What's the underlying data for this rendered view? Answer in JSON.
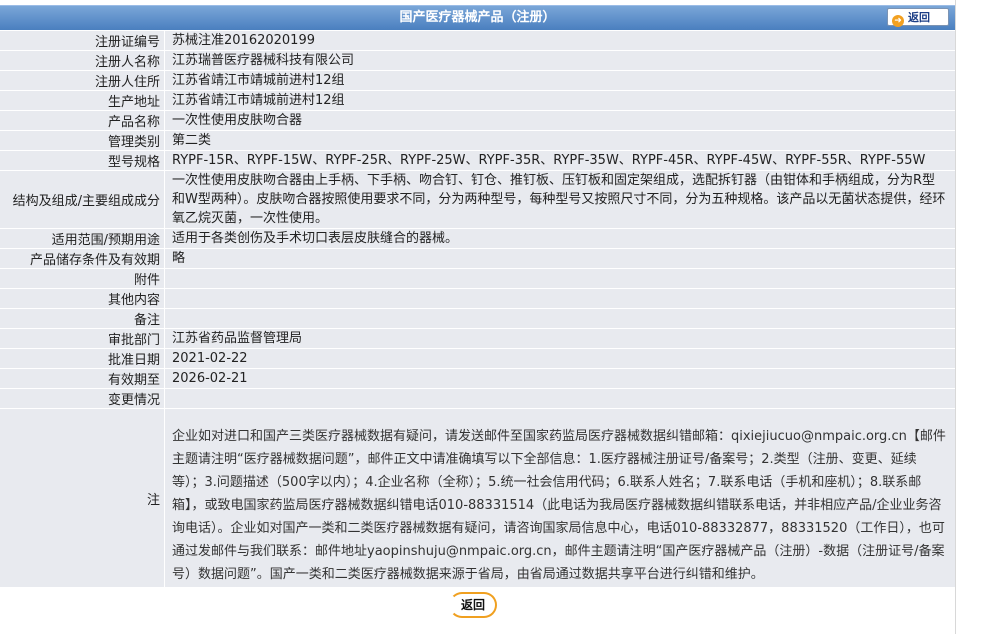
{
  "header": {
    "title": "国产医疗器械产品（注册）",
    "back_label": "返回"
  },
  "rows": [
    {
      "label": "注册证编号",
      "value": "苏械注准20162020199"
    },
    {
      "label": "注册人名称",
      "value": "江苏瑞普医疗器械科技有限公司"
    },
    {
      "label": "注册人住所",
      "value": "江苏省靖江市靖城前进村12组"
    },
    {
      "label": "生产地址",
      "value": "江苏省靖江市靖城前进村12组"
    },
    {
      "label": "产品名称",
      "value": "一次性使用皮肤吻合器"
    },
    {
      "label": "管理类别",
      "value": "第二类"
    },
    {
      "label": "型号规格",
      "value": "RYPF-15R、RYPF-15W、RYPF-25R、RYPF-25W、RYPF-35R、RYPF-35W、RYPF-45R、RYPF-45W、RYPF-55R、RYPF-55W"
    },
    {
      "label": "结构及组成/主要组成成分",
      "value": "一次性使用皮肤吻合器由上手柄、下手柄、吻合钉、钉仓、推钉板、压钉板和固定架组成，选配拆钉器（由钳体和手柄组成，分为R型和W型两种）。皮肤吻合器按照使用要求不同，分为两种型号，每种型号又按照尺寸不同，分为五种规格。该产品以无菌状态提供，经环氧乙烷灭菌，一次性使用。"
    },
    {
      "label": "适用范围/预期用途",
      "value": "适用于各类创伤及手术切口表层皮肤缝合的器械。"
    },
    {
      "label": "产品储存条件及有效期",
      "value": "略"
    },
    {
      "label": "附件",
      "value": ""
    },
    {
      "label": "其他内容",
      "value": ""
    },
    {
      "label": "备注",
      "value": ""
    },
    {
      "label": "审批部门",
      "value": "江苏省药品监督管理局"
    },
    {
      "label": "批准日期",
      "value": "2021-02-22"
    },
    {
      "label": "有效期至",
      "value": "2026-02-21"
    }
  ],
  "change": {
    "label": "变更情况",
    "value": ""
  },
  "notes": {
    "label": "注",
    "value": "企业如对进口和国产三类医疗器械数据有疑问，请发送邮件至国家药监局医疗器械数据纠错邮箱：qixiejiucuo@nmpaic.org.cn【邮件主题请注明“医疗器械数据问题”，邮件正文中请准确填写以下全部信息：1.医疗器械注册证号/备案号；2.类型（注册、变更、延续等）；3.问题描述（500字以内）；4.企业名称（全称）；5.统一社会信用代码；6.联系人姓名；7.联系电话（手机和座机）；8.联系邮箱】，或致电国家药监局医疗器械数据纠错电话010-88331514（此电话为我局医疗器械数据纠错联系电话，并非相应产品/企业业务咨询电话）。企业如对国产一类和二类医疗器械数据有疑问，请咨询国家局信息中心，电话010-88332877，88331520（工作日），也可通过发邮件与我们联系：邮件地址yaopinshuju@nmpaic.org.cn，邮件主题请注明“国产医疗器械产品（注册）-数据（注册证号/备案号）数据问题”。国产一类和二类医疗器械数据来源于省局，由省局通过数据共享平台进行纠错和维护。"
  },
  "footer": {
    "back_label": "返回"
  },
  "colors": {
    "header_bg": "#4a7fbf",
    "row_bg": "#e8eaef",
    "accent": "#f0a020"
  }
}
